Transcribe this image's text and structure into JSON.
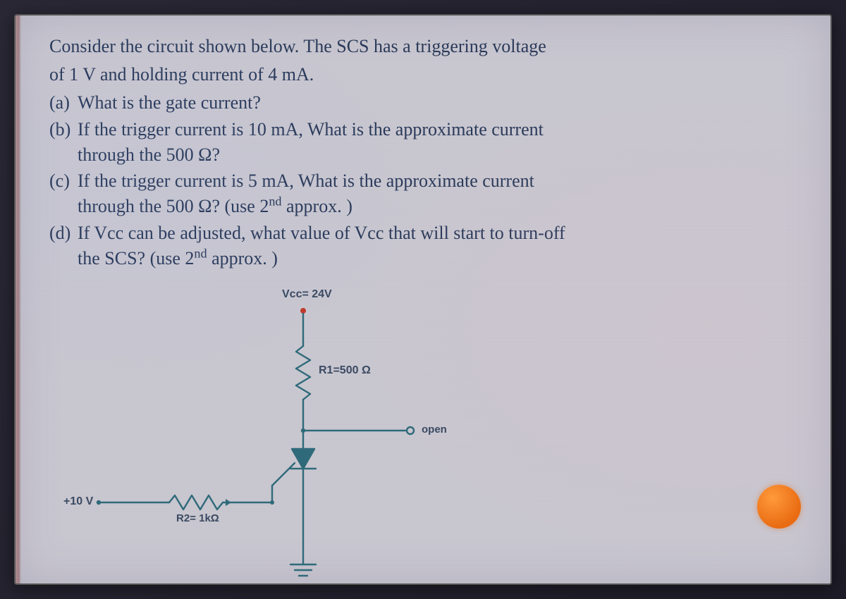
{
  "problem": {
    "intro_line1": "Consider the circuit shown below. The SCS has a triggering voltage",
    "intro_line2": "of 1 V and holding current of 4 mA.",
    "parts": {
      "a": {
        "label": "(a)",
        "text": "What is the gate current?"
      },
      "b": {
        "label": "(b)",
        "line1": "If the trigger current is 10 mA, What is the approximate current",
        "line2": "through the 500 Ω?"
      },
      "c": {
        "label": "(c)",
        "line1": "If the trigger current is 5 mA, What is the approximate current",
        "line2_pre": "through the 500 Ω? (use 2",
        "line2_sup": "nd",
        "line2_post": " approx. )"
      },
      "d": {
        "label": "(d)",
        "line1": "If Vcc can be adjusted, what value of Vcc that will start to turn-off",
        "line2_pre": "the SCS? (use 2",
        "line2_sup": "nd",
        "line2_post": " approx. )"
      }
    }
  },
  "circuit": {
    "vcc_label": "Vcc= 24V",
    "r1_label": "R1=500 Ω",
    "anode_gate_label": "open",
    "vin_label": "+10 V",
    "r2_label": "R2= 1kΩ"
  },
  "colors": {
    "wire": "#2f6a7a",
    "node": "#2f6a7a",
    "text": "#2a3a5a",
    "accent_dot": "#e96b12"
  }
}
